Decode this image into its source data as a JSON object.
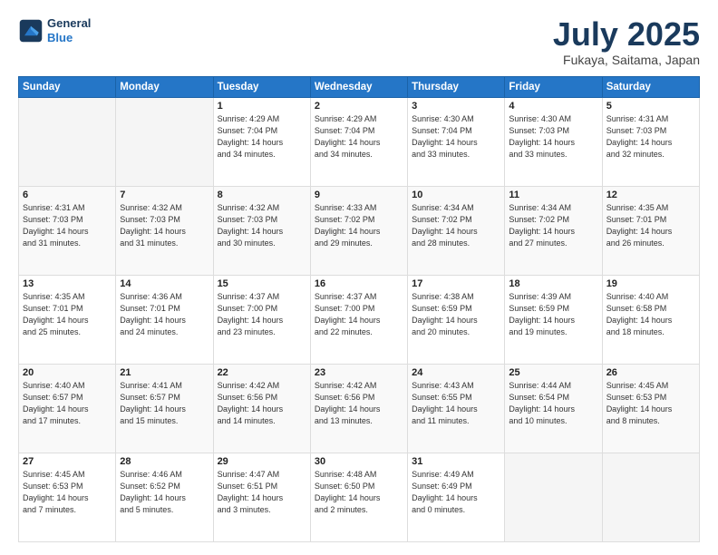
{
  "header": {
    "logo_line1": "General",
    "logo_line2": "Blue",
    "month": "July 2025",
    "location": "Fukaya, Saitama, Japan"
  },
  "weekdays": [
    "Sunday",
    "Monday",
    "Tuesday",
    "Wednesday",
    "Thursday",
    "Friday",
    "Saturday"
  ],
  "weeks": [
    [
      {
        "day": "",
        "lines": [],
        "empty": true
      },
      {
        "day": "",
        "lines": [],
        "empty": true
      },
      {
        "day": "1",
        "lines": [
          "Sunrise: 4:29 AM",
          "Sunset: 7:04 PM",
          "Daylight: 14 hours",
          "and 34 minutes."
        ]
      },
      {
        "day": "2",
        "lines": [
          "Sunrise: 4:29 AM",
          "Sunset: 7:04 PM",
          "Daylight: 14 hours",
          "and 34 minutes."
        ]
      },
      {
        "day": "3",
        "lines": [
          "Sunrise: 4:30 AM",
          "Sunset: 7:04 PM",
          "Daylight: 14 hours",
          "and 33 minutes."
        ]
      },
      {
        "day": "4",
        "lines": [
          "Sunrise: 4:30 AM",
          "Sunset: 7:03 PM",
          "Daylight: 14 hours",
          "and 33 minutes."
        ]
      },
      {
        "day": "5",
        "lines": [
          "Sunrise: 4:31 AM",
          "Sunset: 7:03 PM",
          "Daylight: 14 hours",
          "and 32 minutes."
        ]
      }
    ],
    [
      {
        "day": "6",
        "lines": [
          "Sunrise: 4:31 AM",
          "Sunset: 7:03 PM",
          "Daylight: 14 hours",
          "and 31 minutes."
        ]
      },
      {
        "day": "7",
        "lines": [
          "Sunrise: 4:32 AM",
          "Sunset: 7:03 PM",
          "Daylight: 14 hours",
          "and 31 minutes."
        ]
      },
      {
        "day": "8",
        "lines": [
          "Sunrise: 4:32 AM",
          "Sunset: 7:03 PM",
          "Daylight: 14 hours",
          "and 30 minutes."
        ]
      },
      {
        "day": "9",
        "lines": [
          "Sunrise: 4:33 AM",
          "Sunset: 7:02 PM",
          "Daylight: 14 hours",
          "and 29 minutes."
        ]
      },
      {
        "day": "10",
        "lines": [
          "Sunrise: 4:34 AM",
          "Sunset: 7:02 PM",
          "Daylight: 14 hours",
          "and 28 minutes."
        ]
      },
      {
        "day": "11",
        "lines": [
          "Sunrise: 4:34 AM",
          "Sunset: 7:02 PM",
          "Daylight: 14 hours",
          "and 27 minutes."
        ]
      },
      {
        "day": "12",
        "lines": [
          "Sunrise: 4:35 AM",
          "Sunset: 7:01 PM",
          "Daylight: 14 hours",
          "and 26 minutes."
        ]
      }
    ],
    [
      {
        "day": "13",
        "lines": [
          "Sunrise: 4:35 AM",
          "Sunset: 7:01 PM",
          "Daylight: 14 hours",
          "and 25 minutes."
        ]
      },
      {
        "day": "14",
        "lines": [
          "Sunrise: 4:36 AM",
          "Sunset: 7:01 PM",
          "Daylight: 14 hours",
          "and 24 minutes."
        ]
      },
      {
        "day": "15",
        "lines": [
          "Sunrise: 4:37 AM",
          "Sunset: 7:00 PM",
          "Daylight: 14 hours",
          "and 23 minutes."
        ]
      },
      {
        "day": "16",
        "lines": [
          "Sunrise: 4:37 AM",
          "Sunset: 7:00 PM",
          "Daylight: 14 hours",
          "and 22 minutes."
        ]
      },
      {
        "day": "17",
        "lines": [
          "Sunrise: 4:38 AM",
          "Sunset: 6:59 PM",
          "Daylight: 14 hours",
          "and 20 minutes."
        ]
      },
      {
        "day": "18",
        "lines": [
          "Sunrise: 4:39 AM",
          "Sunset: 6:59 PM",
          "Daylight: 14 hours",
          "and 19 minutes."
        ]
      },
      {
        "day": "19",
        "lines": [
          "Sunrise: 4:40 AM",
          "Sunset: 6:58 PM",
          "Daylight: 14 hours",
          "and 18 minutes."
        ]
      }
    ],
    [
      {
        "day": "20",
        "lines": [
          "Sunrise: 4:40 AM",
          "Sunset: 6:57 PM",
          "Daylight: 14 hours",
          "and 17 minutes."
        ]
      },
      {
        "day": "21",
        "lines": [
          "Sunrise: 4:41 AM",
          "Sunset: 6:57 PM",
          "Daylight: 14 hours",
          "and 15 minutes."
        ]
      },
      {
        "day": "22",
        "lines": [
          "Sunrise: 4:42 AM",
          "Sunset: 6:56 PM",
          "Daylight: 14 hours",
          "and 14 minutes."
        ]
      },
      {
        "day": "23",
        "lines": [
          "Sunrise: 4:42 AM",
          "Sunset: 6:56 PM",
          "Daylight: 14 hours",
          "and 13 minutes."
        ]
      },
      {
        "day": "24",
        "lines": [
          "Sunrise: 4:43 AM",
          "Sunset: 6:55 PM",
          "Daylight: 14 hours",
          "and 11 minutes."
        ]
      },
      {
        "day": "25",
        "lines": [
          "Sunrise: 4:44 AM",
          "Sunset: 6:54 PM",
          "Daylight: 14 hours",
          "and 10 minutes."
        ]
      },
      {
        "day": "26",
        "lines": [
          "Sunrise: 4:45 AM",
          "Sunset: 6:53 PM",
          "Daylight: 14 hours",
          "and 8 minutes."
        ]
      }
    ],
    [
      {
        "day": "27",
        "lines": [
          "Sunrise: 4:45 AM",
          "Sunset: 6:53 PM",
          "Daylight: 14 hours",
          "and 7 minutes."
        ]
      },
      {
        "day": "28",
        "lines": [
          "Sunrise: 4:46 AM",
          "Sunset: 6:52 PM",
          "Daylight: 14 hours",
          "and 5 minutes."
        ]
      },
      {
        "day": "29",
        "lines": [
          "Sunrise: 4:47 AM",
          "Sunset: 6:51 PM",
          "Daylight: 14 hours",
          "and 3 minutes."
        ]
      },
      {
        "day": "30",
        "lines": [
          "Sunrise: 4:48 AM",
          "Sunset: 6:50 PM",
          "Daylight: 14 hours",
          "and 2 minutes."
        ]
      },
      {
        "day": "31",
        "lines": [
          "Sunrise: 4:49 AM",
          "Sunset: 6:49 PM",
          "Daylight: 14 hours",
          "and 0 minutes."
        ]
      },
      {
        "day": "",
        "lines": [],
        "empty": true
      },
      {
        "day": "",
        "lines": [],
        "empty": true
      }
    ]
  ]
}
